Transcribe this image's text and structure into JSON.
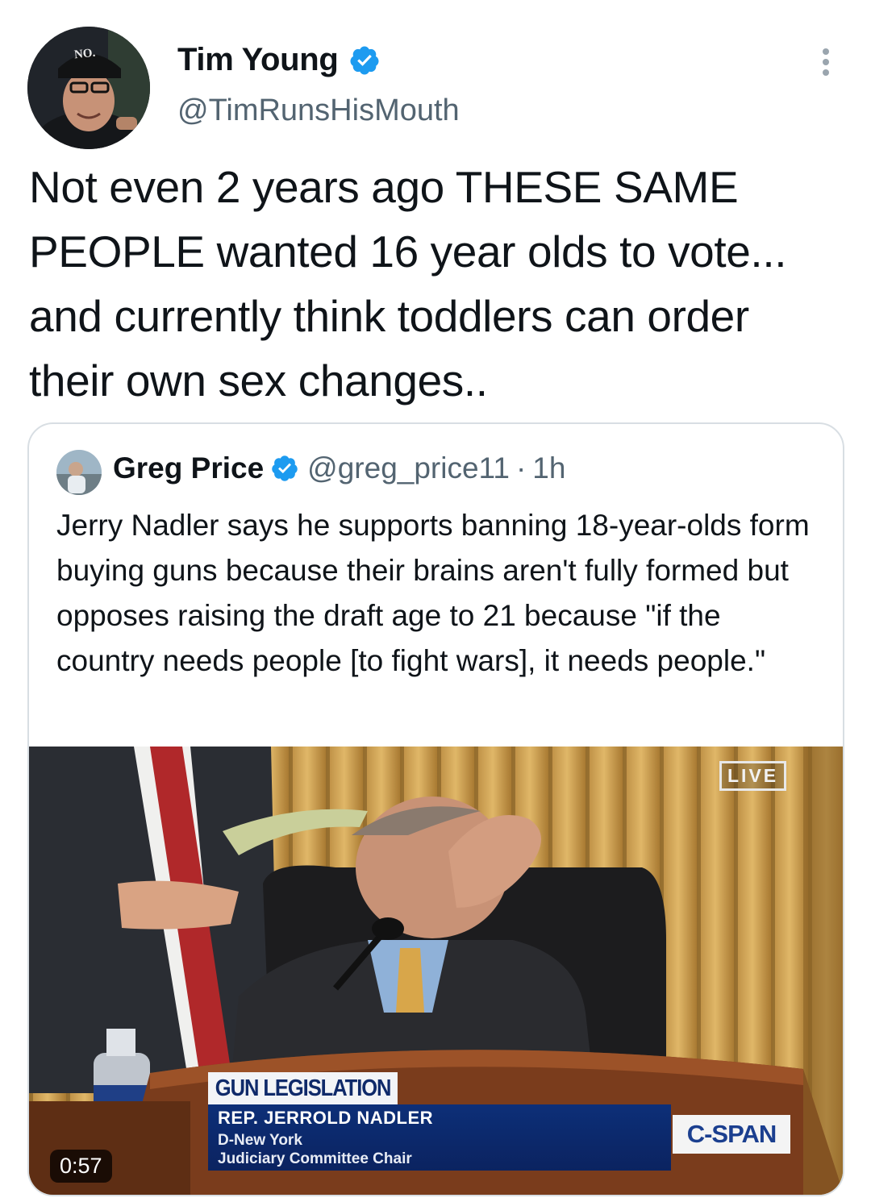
{
  "author": {
    "name": "Tim Young",
    "handle": "@TimRunsHisMouth",
    "verified": true,
    "avatar_cap_text": "NO."
  },
  "tweet": {
    "text": "Not even 2 years ago THESE SAME PEOPLE wanted 16 year olds to vote... and currently think toddlers can order their own sex changes.."
  },
  "quoted_tweet": {
    "name": "Greg Price",
    "handle": "@greg_price11",
    "separator": "·",
    "time": "1h",
    "verified": true,
    "text": "Jerry Nadler says he supports banning 18-year-olds form buying guns because their brains aren't fully formed but opposes raising the draft age to 21 because \"if the country needs people [to fight wars], it needs people.\"",
    "video": {
      "live_label": "LIVE",
      "chyron_title": "GUN LEGISLATION",
      "chyron_name": "REP. JERROLD NADLER",
      "chyron_line2": "D-New York",
      "chyron_line3": "Judiciary Committee Chair",
      "network": "C-SPAN",
      "duration": "0:57"
    }
  },
  "colors": {
    "text_primary": "#0f1419",
    "text_secondary": "#536471",
    "verified_blue": "#1d9bf0",
    "quote_border": "#d8dee3"
  },
  "icons": {
    "verified": "verified-badge-icon",
    "more": "more-options-icon"
  }
}
